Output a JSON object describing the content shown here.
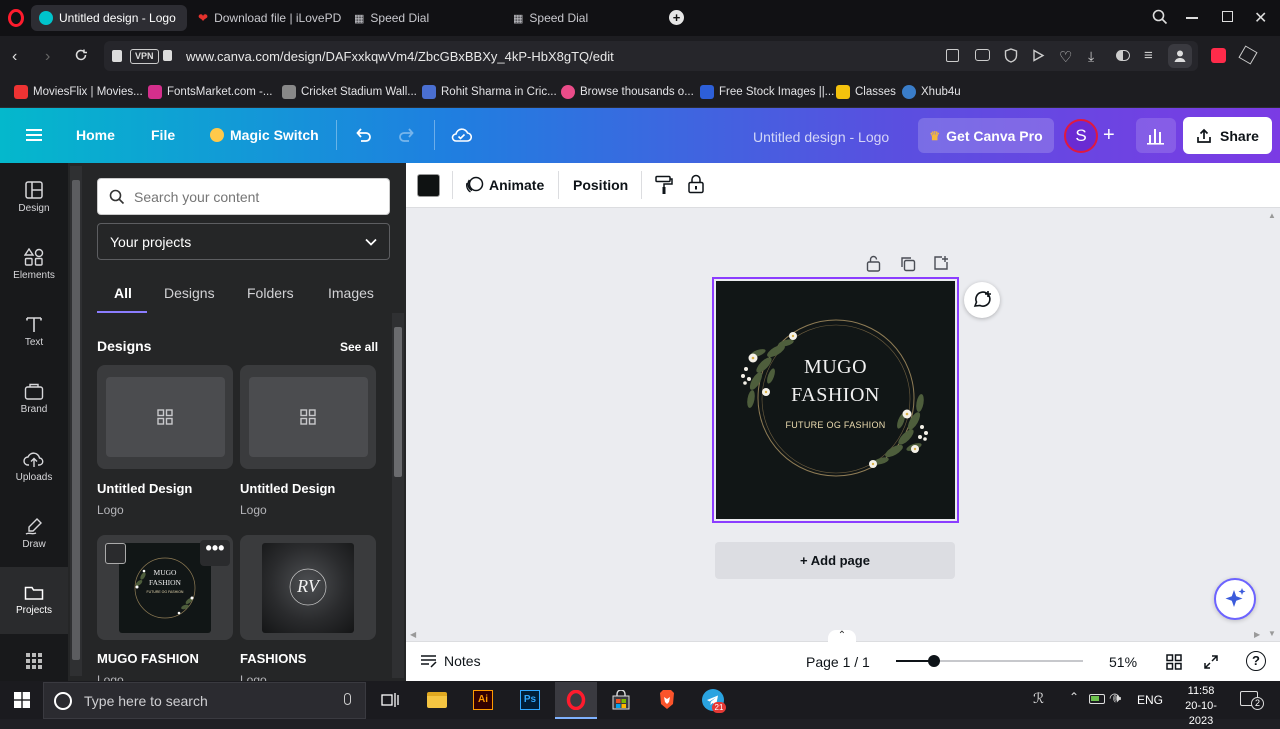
{
  "browser": {
    "tabs": [
      {
        "label": "Untitled design - Logo",
        "active": true
      },
      {
        "label": "Download file | iLovePDF",
        "active": false
      },
      {
        "label": "Speed Dial",
        "active": false
      },
      {
        "label": "Speed Dial",
        "active": false
      }
    ],
    "vpn_badge": "VPN",
    "url": "www.canva.com/design/DAFxxkqwVm4/ZbcGBxBBXy_4kP-HbX8gTQ/edit",
    "bookmarks": [
      {
        "label": "MoviesFlix | Movies..."
      },
      {
        "label": "FontsMarket.com -..."
      },
      {
        "label": "Cricket Stadium Wall..."
      },
      {
        "label": "Rohit Sharma in Cric..."
      },
      {
        "label": "Browse thousands o..."
      },
      {
        "label": "Free Stock Images ||..."
      },
      {
        "label": "Classes"
      },
      {
        "label": "Xhub4u"
      }
    ]
  },
  "header": {
    "home": "Home",
    "file": "File",
    "magic_switch": "Magic Switch",
    "doc_title": "Untitled design - Logo",
    "get_pro": "Get Canva Pro",
    "avatar": "S",
    "share": "Share"
  },
  "rail": [
    {
      "label": "Design"
    },
    {
      "label": "Elements"
    },
    {
      "label": "Text"
    },
    {
      "label": "Brand"
    },
    {
      "label": "Uploads"
    },
    {
      "label": "Draw"
    },
    {
      "label": "Projects"
    }
  ],
  "panel": {
    "search_placeholder": "Search your content",
    "projects_select": "Your projects",
    "tabs": [
      "All",
      "Designs",
      "Folders",
      "Images"
    ],
    "section_title": "Designs",
    "see_all": "See all",
    "cards": [
      {
        "title": "Untitled Design",
        "subtitle": "Logo"
      },
      {
        "title": "Untitled Design",
        "subtitle": "Logo"
      },
      {
        "title": "MUGO FASHION",
        "subtitle": "Logo"
      },
      {
        "title": "FASHIONS",
        "subtitle": "Logo"
      }
    ],
    "thumb_logo_line1": "MUGO",
    "thumb_logo_line2": "FASHION",
    "thumb_logo_tagline": "FUTURE OG FASHION",
    "thumb_monogram": "RV"
  },
  "toolbar": {
    "color_swatch": "#0f1212",
    "animate": "Animate",
    "position": "Position"
  },
  "design": {
    "line1": "MUGO",
    "line2": "FASHION",
    "tagline": "FUTURE OG FASHION",
    "bg": "#111616"
  },
  "add_page": "+ Add page",
  "footer": {
    "notes": "Notes",
    "page": "Page 1 / 1",
    "zoom_value": 51,
    "zoom": "51%"
  },
  "taskbar": {
    "search_placeholder": "Type here to search",
    "lang": "ENG",
    "time": "11:58",
    "date": "20-10-2023",
    "notif_count": "2",
    "telegram_badge": "21"
  },
  "colors": {
    "accent": "#8b3dff",
    "pro_crown": "#f5b83d",
    "avatar_border": "#e0193f"
  }
}
